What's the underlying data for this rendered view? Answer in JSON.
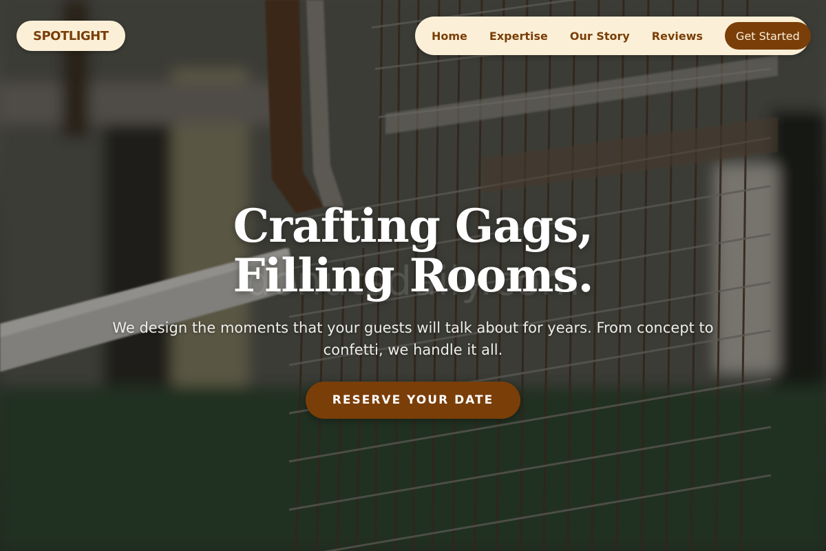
{
  "header": {
    "logo": "SPOTLIGHT",
    "nav": [
      {
        "label": "Home"
      },
      {
        "label": "Expertise"
      },
      {
        "label": "Our Story"
      },
      {
        "label": "Reviews"
      }
    ],
    "cta_label": "Get Started"
  },
  "hero": {
    "title": "Crafting Gags, Filling Rooms.",
    "subtitle": "We design the moments that your guests will talk about for years. From concept to confetti, we handle it all.",
    "cta_label": "RESERVE YOUR DATE",
    "watermark": "donutsdaily.com",
    "background_image": "blurred metal wire mesh cage"
  },
  "colors": {
    "brand_brown": "#7a3e09",
    "cream": "#fbf0d7",
    "text_white": "#ffffff"
  }
}
